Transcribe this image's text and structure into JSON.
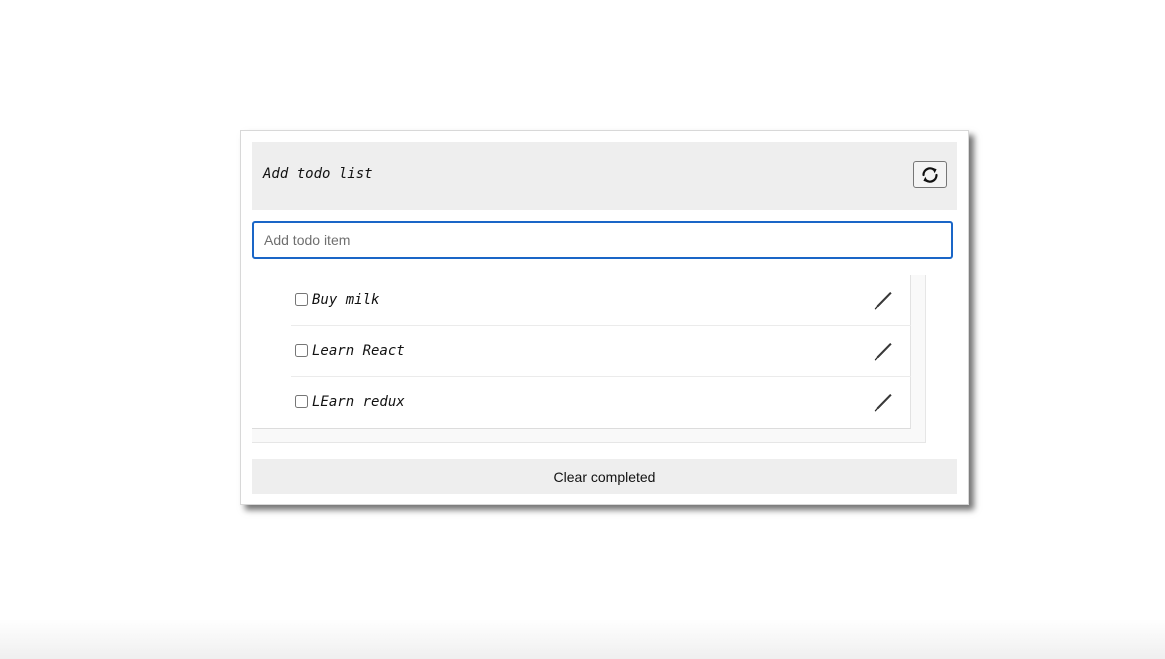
{
  "header": {
    "title": "Add todo list",
    "refresh_icon": "refresh-icon"
  },
  "input": {
    "placeholder": "Add todo item",
    "value": ""
  },
  "todos": [
    {
      "label": "Buy milk",
      "completed": false,
      "edit_icon": "pencil-icon"
    },
    {
      "label": "Learn React",
      "completed": false,
      "edit_icon": "pencil-icon"
    },
    {
      "label": "LEarn redux",
      "completed": false,
      "edit_icon": "pencil-icon"
    }
  ],
  "footer": {
    "clear_label": "Clear completed"
  },
  "colors": {
    "header_bg": "#eeeeee",
    "input_border": "#1a66c7",
    "card_bg": "#ffffff"
  }
}
